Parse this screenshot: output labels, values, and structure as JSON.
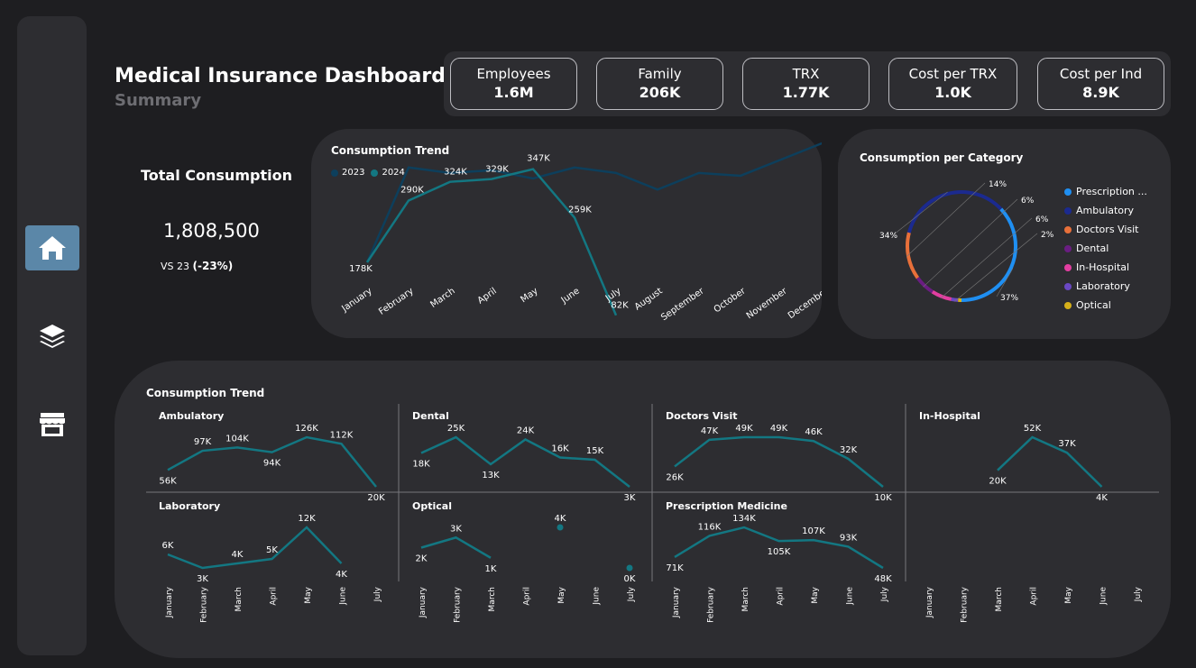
{
  "dashboard": {
    "title": "Medical Insurance Dashboard",
    "subtitle": "Summary"
  },
  "colors": {
    "bg": "#1e1e21",
    "card": "#2d2d31",
    "line": "#137782",
    "line_2023": "#0d3f5c",
    "accent_nav": "#5b87a8"
  },
  "nav": [
    {
      "icon": "home-icon",
      "active": true
    },
    {
      "icon": "layers-icon",
      "active": false
    },
    {
      "icon": "store-icon",
      "active": false
    }
  ],
  "kpis": [
    {
      "label": "Employees",
      "value": "1.6M"
    },
    {
      "label": "Family",
      "value": "206K"
    },
    {
      "label": "TRX",
      "value": "1.77K"
    },
    {
      "label": "Cost per TRX",
      "value": "1.0K"
    },
    {
      "label": "Cost per Ind",
      "value": "8.9K"
    }
  ],
  "total": {
    "title": "Total Consumption",
    "value": "1,808,500",
    "vs_label": "VS 23",
    "vs_change": "(-23%)"
  },
  "chart_data": [
    {
      "type": "line",
      "title": "Consumption Trend",
      "categories": [
        "January",
        "February",
        "March",
        "April",
        "May",
        "June",
        "July",
        "August",
        "September",
        "October",
        "November",
        "December"
      ],
      "series": [
        {
          "name": "2023",
          "color": "#0d3f5c",
          "values": [
            178000,
            350000,
            340000,
            345000,
            330000,
            350000,
            340000,
            310000,
            340000,
            335000,
            365000,
            395000
          ]
        },
        {
          "name": "2024",
          "color": "#137782",
          "values": [
            178000,
            290000,
            324000,
            329000,
            347000,
            259000,
            82000
          ]
        }
      ],
      "data_labels": [
        "178K",
        "290K",
        "324K",
        "329K",
        "347K",
        "259K",
        "82K"
      ],
      "legend": "top-left"
    },
    {
      "type": "pie",
      "title": "Consumption per Category",
      "categories": [
        "Prescription ...",
        "Ambulatory",
        "Doctors Visit",
        "Dental",
        "In-Hospital",
        "Laboratory",
        "Optical"
      ],
      "values": [
        37,
        34,
        14,
        6,
        6,
        2,
        1
      ],
      "labels": [
        "37%",
        "34%",
        "14%",
        "6%",
        "6%",
        "2%",
        ""
      ],
      "colors": [
        "#1f8ff2",
        "#1b2a8f",
        "#e8703a",
        "#6a1d82",
        "#e23ea1",
        "#6a48c4",
        "#d6b01a"
      ],
      "legend": "right"
    },
    {
      "type": "line",
      "title": "Consumption Trend",
      "categories": [
        "January",
        "February",
        "March",
        "April",
        "May",
        "June",
        "July"
      ],
      "panels": [
        {
          "name": "Ambulatory",
          "values": [
            56000,
            97000,
            104000,
            94000,
            126000,
            112000,
            20000
          ],
          "labels": [
            "56K",
            "97K",
            "104K",
            "94K",
            "126K",
            "112K",
            "20K"
          ]
        },
        {
          "name": "Dental",
          "values": [
            18000,
            25000,
            13000,
            24000,
            16000,
            15000,
            3000
          ],
          "labels": [
            "18K",
            "25K",
            "13K",
            "24K",
            "16K",
            "15K",
            "3K"
          ]
        },
        {
          "name": "Doctors Visit",
          "values": [
            26000,
            47000,
            49000,
            49000,
            46000,
            32000,
            10000
          ],
          "labels": [
            "26K",
            "47K",
            "49K",
            "49K",
            "46K",
            "32K",
            "10K"
          ]
        },
        {
          "name": "In-Hospital",
          "values": [
            null,
            null,
            20000,
            52000,
            37000,
            4000,
            null
          ],
          "labels": [
            "",
            "",
            "20K",
            "52K",
            "37K",
            "4K",
            ""
          ]
        },
        {
          "name": "Laboratory",
          "values": [
            6000,
            3000,
            4000,
            5000,
            12000,
            4000,
            null
          ],
          "labels": [
            "6K",
            "3K",
            "4K",
            "5K",
            "12K",
            "4K",
            ""
          ]
        },
        {
          "name": "Optical",
          "values": [
            2000,
            3000,
            1000,
            null,
            4000,
            null,
            0
          ],
          "labels": [
            "2K",
            "3K",
            "1K",
            "",
            "4K",
            "",
            "0K"
          ]
        },
        {
          "name": "Prescription Medicine",
          "values": [
            71000,
            116000,
            134000,
            105000,
            107000,
            93000,
            48000
          ],
          "labels": [
            "71K",
            "116K",
            "134K",
            "105K",
            "107K",
            "93K",
            "48K"
          ]
        }
      ]
    }
  ]
}
